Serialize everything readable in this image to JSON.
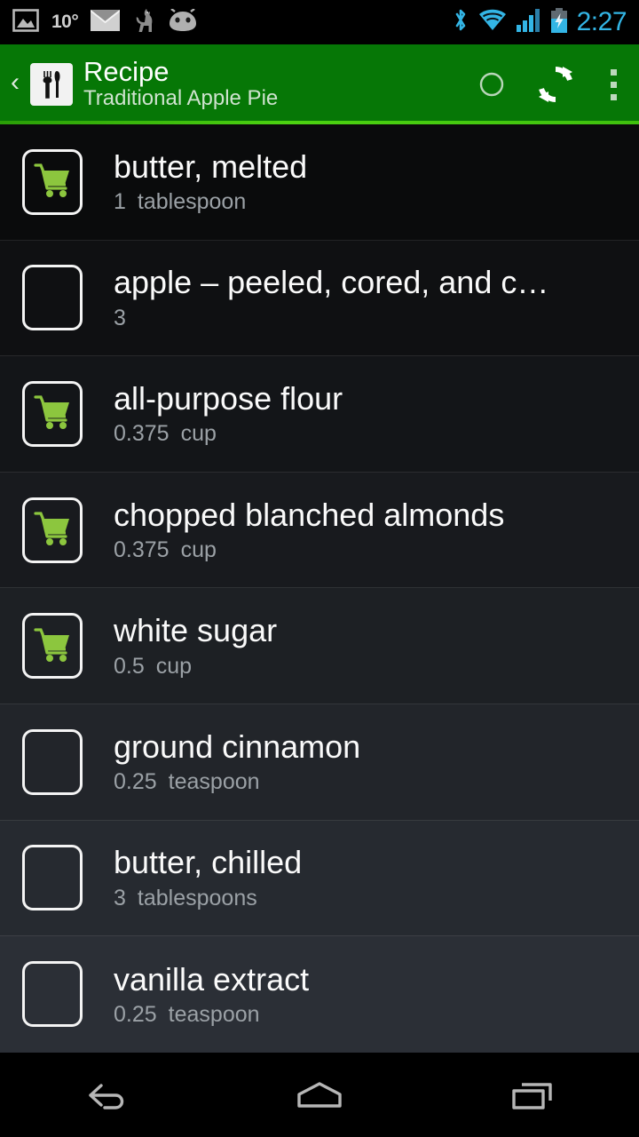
{
  "status_bar": {
    "temperature": "10°",
    "time": "2:27",
    "left_icons": [
      "photo-icon",
      "mail-icon",
      "llama-icon",
      "android-face-icon"
    ],
    "right_icons": [
      "bluetooth-icon",
      "wifi-icon",
      "cellular-signal-icon",
      "battery-charging-icon"
    ],
    "clock_color": "#33b5e5"
  },
  "action_bar": {
    "back_glyph": "‹",
    "app_icon": "fork-knife-icon",
    "title": "Recipe",
    "subtitle": "Traditional Apple Pie",
    "circle_action": "circle-icon",
    "sync_action": "sync-refresh-icon",
    "overflow": "overflow-menu-icon",
    "background_color": "#067706",
    "underline_color": "#4cd211"
  },
  "cart_color": "#8cc63e",
  "ingredients": [
    {
      "name": "butter, melted",
      "quantity": "1",
      "unit": "tablespoon",
      "in_cart": true
    },
    {
      "name": "apple – peeled, cored, and c…",
      "quantity": "3",
      "unit": "",
      "in_cart": false
    },
    {
      "name": "all-purpose flour",
      "quantity": "0.375",
      "unit": "cup",
      "in_cart": true
    },
    {
      "name": "chopped blanched almonds",
      "quantity": "0.375",
      "unit": "cup",
      "in_cart": true
    },
    {
      "name": "white sugar",
      "quantity": "0.5",
      "unit": "cup",
      "in_cart": true
    },
    {
      "name": "ground cinnamon",
      "quantity": "0.25",
      "unit": "teaspoon",
      "in_cart": false
    },
    {
      "name": "butter, chilled",
      "quantity": "3",
      "unit": "tablespoons",
      "in_cart": false
    },
    {
      "name": "vanilla extract",
      "quantity": "0.25",
      "unit": "teaspoon",
      "in_cart": false
    }
  ],
  "nav_bar": {
    "back": "nav-back-icon",
    "home": "nav-home-icon",
    "recents": "nav-recents-icon"
  }
}
